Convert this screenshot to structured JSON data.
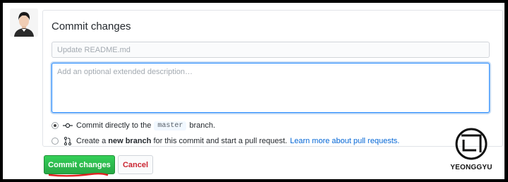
{
  "avatar": {
    "alt": "user avatar"
  },
  "panel": {
    "title": "Commit changes",
    "summary_placeholder": "Update README.md",
    "description_placeholder": "Add an optional extended description…"
  },
  "options": {
    "direct": {
      "selected": true,
      "icon": "git-commit-icon",
      "text_before": "Commit directly to the",
      "branch": "master",
      "text_after": "branch."
    },
    "new_branch": {
      "selected": false,
      "icon": "git-pull-request-icon",
      "text_before": "Create a",
      "bold": "new branch",
      "text_after": "for this commit and start a pull request.",
      "link": "Learn more about pull requests."
    }
  },
  "buttons": {
    "commit": "Commit changes",
    "cancel": "Cancel"
  },
  "watermark": {
    "text": "YEONGGYU"
  },
  "colors": {
    "commit_green": "#28a745",
    "cancel_red": "#cb2431",
    "link_blue": "#0366d6",
    "annotation_red": "#e02020"
  }
}
